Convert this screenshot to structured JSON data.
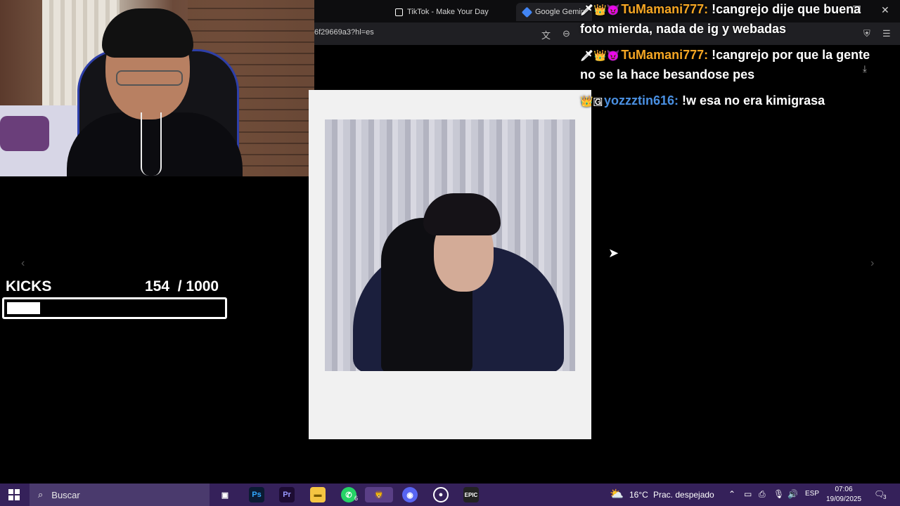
{
  "browser": {
    "tabs": [
      {
        "label": "TikTok - Make Your Day"
      },
      {
        "label": "Google Gemin"
      }
    ],
    "url": "6f29669a3?hl=es"
  },
  "kicks": {
    "label": "KICKS",
    "current": "154",
    "goal": "/ 1000",
    "progress_fraction": 0.154
  },
  "chat": [
    {
      "badges": "🗡👑😈",
      "user": "TuMamani777:",
      "message": "!cangrejo dije que buena foto mierda, nada de ig y webadas",
      "color": "#f5a623"
    },
    {
      "badges": "🗡👑😈",
      "user": "TuMamani777:",
      "message": "!cangrejo por que la gente no se la hace besandose pes",
      "color": "#f5a623"
    },
    {
      "badges": "👑🇬",
      "user": "yozzztin616:",
      "message": "!w esa no era kimigrasa",
      "color": "#4a90e2"
    }
  ],
  "taskbar": {
    "search_placeholder": "Buscar",
    "weather_temp": "16°C",
    "weather_desc": "Prac. despejado",
    "language": "ESP",
    "time": "07:06",
    "date": "19/09/2025",
    "whatsapp_badge": "6",
    "notification_badge": "3",
    "apps": [
      "Ps",
      "Pr",
      "EPIC"
    ]
  }
}
